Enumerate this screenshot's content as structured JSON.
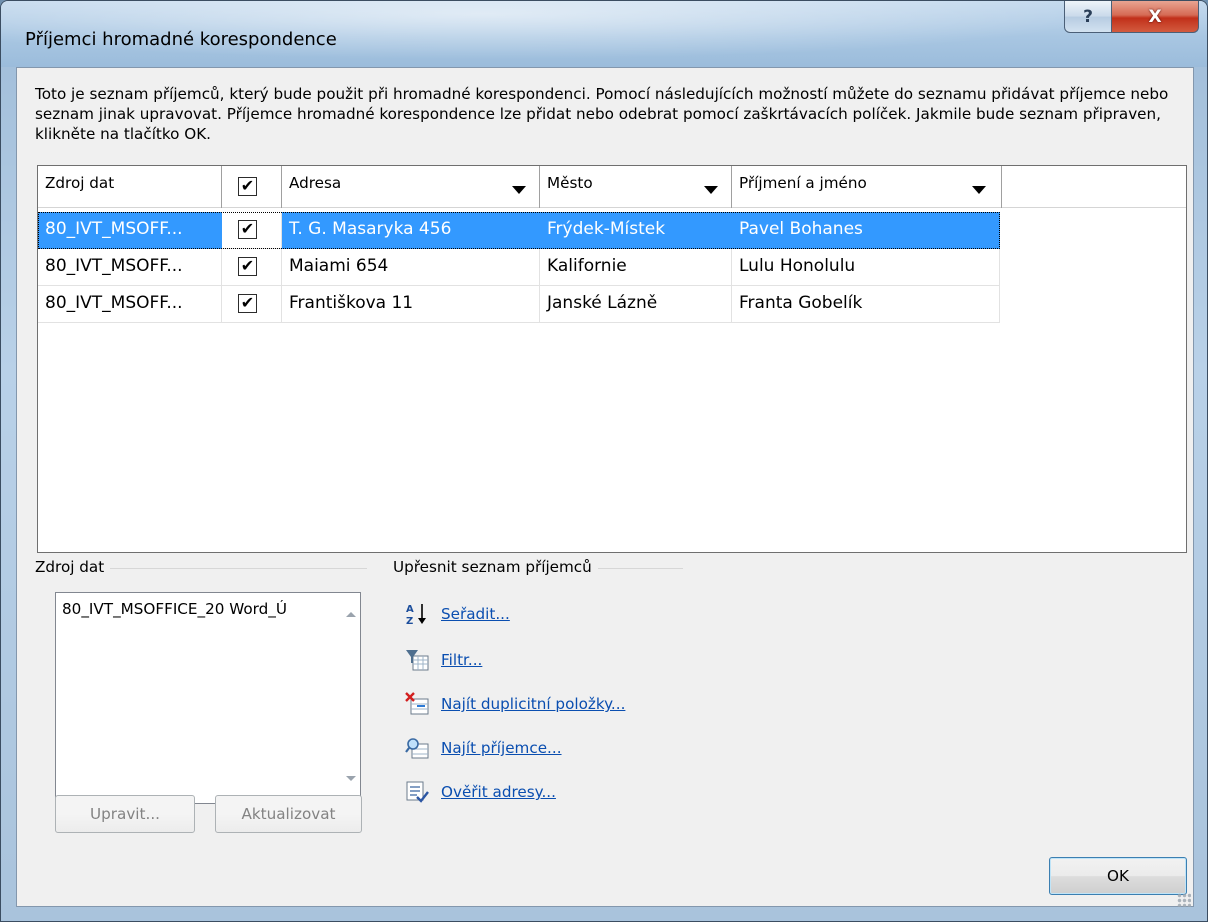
{
  "window": {
    "title": "Příjemci hromadné korespondence",
    "help_label": "?",
    "close_label": "X"
  },
  "intro_text": "Toto je seznam příjemců, který bude použit při hromadné korespondenci. Pomocí následujících možností můžete do seznamu přidávat příjemce nebo seznam jinak upravovat. Příjemce hromadné korespondence lze přidat nebo odebrat pomocí zaškrtávacích políček. Jakmile bude seznam připraven, klikněte na tlačítko OK.",
  "table": {
    "columns": {
      "source": "Zdroj dat",
      "address": "Adresa",
      "city": "Město",
      "name": "Příjmení a jméno"
    },
    "header_checked": true,
    "rows": [
      {
        "source": "80_IVT_MSOFF...",
        "checked": true,
        "address": "T. G. Masaryka 456",
        "city": "Frýdek-Místek",
        "name": "Pavel Bohanes",
        "selected": true
      },
      {
        "source": "80_IVT_MSOFF...",
        "checked": true,
        "address": "Maiami 654",
        "city": "Kalifornie",
        "name": "Lulu Honolulu",
        "selected": false
      },
      {
        "source": "80_IVT_MSOFF...",
        "checked": true,
        "address": "Františkova 11",
        "city": "Janské Lázně",
        "name": "Franta Gobelík",
        "selected": false
      }
    ]
  },
  "data_source": {
    "label": "Zdroj dat",
    "items": [
      "80_IVT_MSOFFICE_20 Word_Ú"
    ],
    "edit_label": "Upravit...",
    "refresh_label": "Aktualizovat"
  },
  "refine": {
    "label": "Upřesnit seznam příjemců",
    "links": [
      {
        "icon": "sort-icon",
        "label": "Seřadit..."
      },
      {
        "icon": "filter-icon",
        "label": "Filtr..."
      },
      {
        "icon": "find-duplicates-icon",
        "label": "Najít duplicitní položky..."
      },
      {
        "icon": "find-recipient-icon",
        "label": "Najít příjemce..."
      },
      {
        "icon": "validate-addresses-icon",
        "label": "Ověřit adresy..."
      }
    ]
  },
  "ok_label": "OK",
  "colors": {
    "selection": "#3399ff",
    "link": "#0a4eb0",
    "dialog_bg": "#f0f0f0"
  }
}
